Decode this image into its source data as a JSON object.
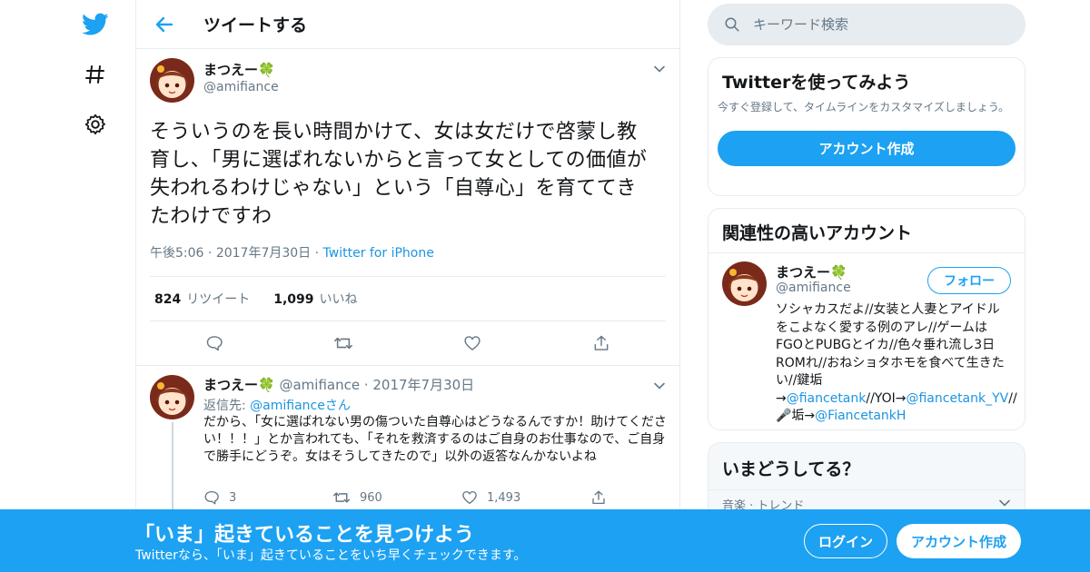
{
  "header": {
    "title": "ツイートする"
  },
  "tweet": {
    "author_name": "まつえー🍀",
    "author_handle": "@amifiance",
    "text": "そういうのを長い時間かけて、女は女だけで啓蒙し教育し、「男に選ばれないからと言って女としての価値が失われるわけじゃない」という「自尊心」を育ててきたわけですわ",
    "time": "午後5:06",
    "date": "2017年7月30日",
    "source": "Twitter for iPhone",
    "retweets_count": "824",
    "retweets_label": "リツイート",
    "likes_count": "1,099",
    "likes_label": "いいね"
  },
  "reply": {
    "author_name": "まつえー🍀",
    "author_handle": "@amifiance",
    "date": "2017年7月30日",
    "reply_to_label": "返信先: ",
    "reply_to_handle": "@amifiance",
    "reply_to_suffix": "さん",
    "text": "だから、「女に選ばれない男の傷ついた自尊心はどうなるんですか！助けてください！！！」とか言われても、「それを救済するのはご自身のお仕事なので、ご自身で勝手にどうぞ。女はそうしてきたので」以外の返答なんかないよね",
    "replies": "3",
    "retweets": "960",
    "likes": "1,493"
  },
  "search": {
    "placeholder": "キーワード検索"
  },
  "signup_card": {
    "title": "Twitterを使ってみよう",
    "description": "今すぐ登録して、タイムラインをカスタマイズしましょう。",
    "button": "アカウント作成"
  },
  "related": {
    "title": "関連性の高いアカウント",
    "name": "まつえー🍀",
    "handle": "@amifiance",
    "follow": "フォロー",
    "bio_text": "ソシャカスだよ//女装と人妻とアイドルをこよなく愛する例のアレ//ゲームはFGOとPUBGとイカ//色々垂れ流し3日ROMれ//おねショタホモを食べて生きたい//鍵垢→",
    "bio_link1": "@fiancetank",
    "bio_mid1": "//YOI→",
    "bio_link2": "@fiancetank_YV",
    "bio_mid2": "//🎤垢→",
    "bio_link3": "@FiancetankH"
  },
  "trends": {
    "title": "いまどうしてる？",
    "category": "音楽 · トレンド"
  },
  "bottom_bar": {
    "title": "「いま」起きていることを見つけよう",
    "subtitle": "Twitterなら、「いま」起きていることをいち早くチェックできます。",
    "login": "ログイン",
    "signup": "アカウント作成"
  },
  "colors": {
    "brand": "#1da1f2",
    "link": "#1b95e0",
    "muted": "#657786"
  },
  "icons": [
    "twitter-bird-icon",
    "hashtag-icon",
    "settings-gear-icon",
    "back-arrow-icon",
    "search-icon",
    "reply-icon",
    "retweet-icon",
    "like-icon",
    "share-icon",
    "chevron-down-icon"
  ]
}
